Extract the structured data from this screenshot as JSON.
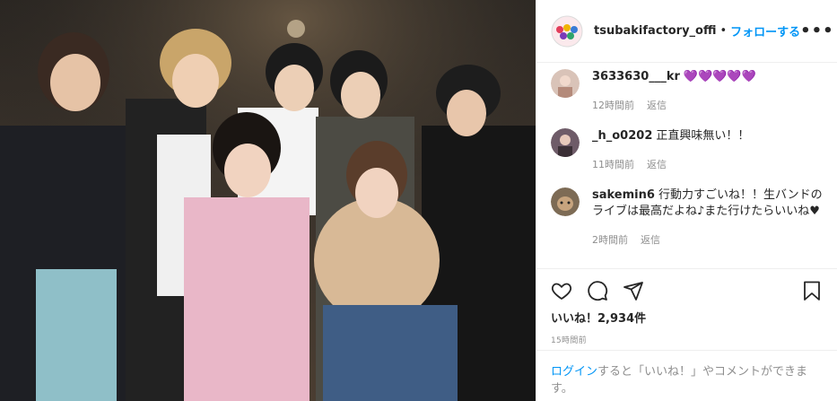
{
  "post": {
    "username": "tsubakifactory_offi",
    "separator": "•",
    "follow_label": "フォローする",
    "more_label": "•••",
    "likes_label": "いいね！2,934件",
    "timestamp": "15時間前"
  },
  "comments": [
    {
      "user": "3633630___kr",
      "text": "💜💜💜💜💜",
      "time": "12時間前",
      "reply": "返信"
    },
    {
      "user": "_h_o0202",
      "text": "正直興味無い！！",
      "time": "11時間前",
      "reply": "返信"
    },
    {
      "user": "sakemin6",
      "text": "行動力すごいね！！生バンドのライブは最高だよね♪また行けたらいいね♥",
      "time": "2時間前",
      "reply": "返信"
    }
  ],
  "login_prompt": {
    "link": "ログイン",
    "rest": "すると「いいね！」やコメントができます。"
  },
  "icons": [
    "heart-icon",
    "comment-icon",
    "share-icon",
    "bookmark-icon"
  ],
  "colors": {
    "link": "#0095f6",
    "meta": "#8e8e8e",
    "heart": "#8a5cd6"
  }
}
